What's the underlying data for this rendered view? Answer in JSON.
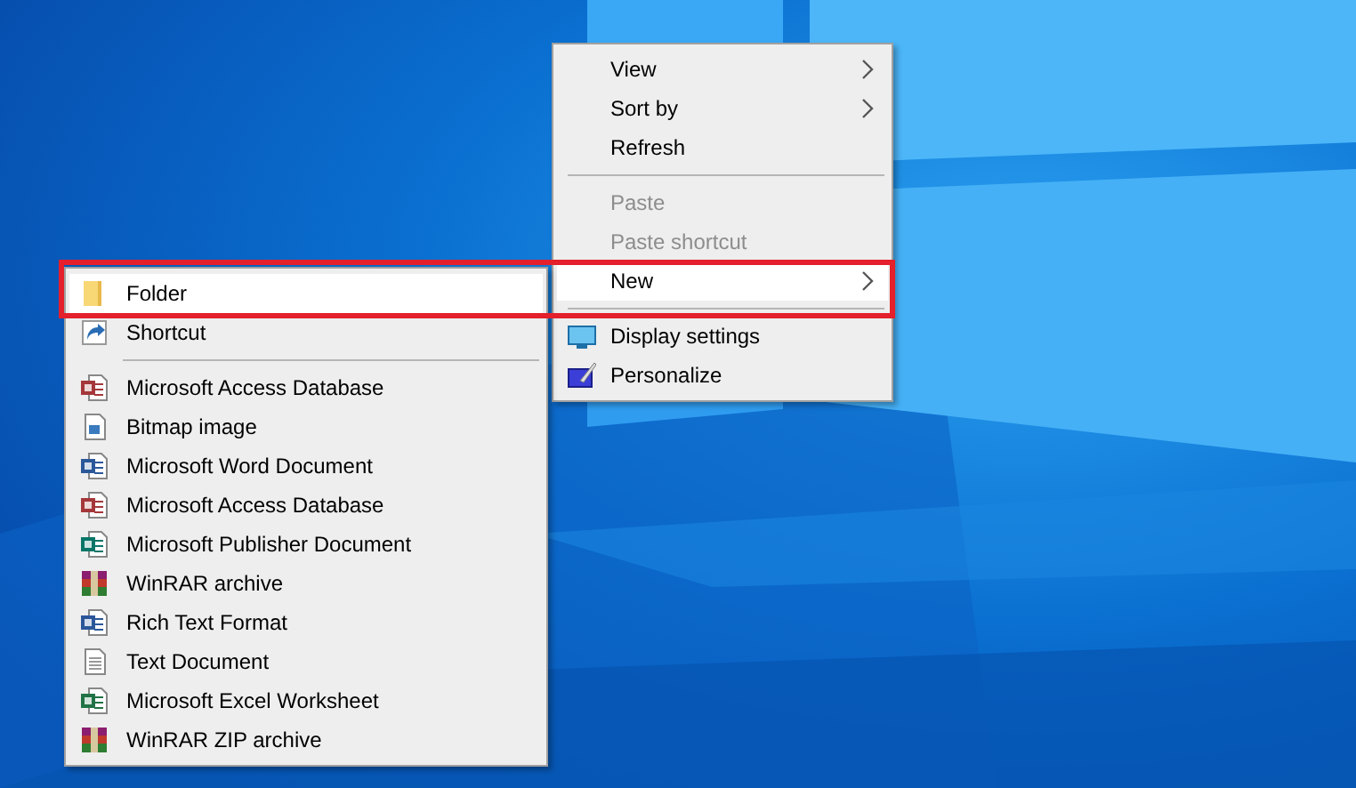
{
  "desktop_menu": {
    "items": [
      {
        "kind": "item",
        "label": "View",
        "submenu": true,
        "disabled": false,
        "selected": false
      },
      {
        "kind": "item",
        "label": "Sort by",
        "submenu": true,
        "disabled": false,
        "selected": false
      },
      {
        "kind": "item",
        "label": "Refresh",
        "submenu": false,
        "disabled": false,
        "selected": false
      },
      {
        "kind": "separator"
      },
      {
        "kind": "item",
        "label": "Paste",
        "submenu": false,
        "disabled": true,
        "selected": false
      },
      {
        "kind": "item",
        "label": "Paste shortcut",
        "submenu": false,
        "disabled": true,
        "selected": false
      },
      {
        "kind": "item",
        "label": "New",
        "submenu": true,
        "disabled": false,
        "selected": true
      },
      {
        "kind": "separator"
      },
      {
        "kind": "display",
        "label": "Display settings",
        "submenu": false,
        "disabled": false,
        "selected": false
      },
      {
        "kind": "personalize",
        "label": "Personalize",
        "submenu": false,
        "disabled": false,
        "selected": false
      }
    ]
  },
  "new_submenu": {
    "items": [
      {
        "kind": "folder",
        "label": "Folder",
        "selected": true
      },
      {
        "kind": "shortcut",
        "label": "Shortcut",
        "selected": false
      },
      {
        "kind": "separator"
      },
      {
        "kind": "access",
        "label": "Microsoft Access Database",
        "selected": false
      },
      {
        "kind": "bitmap",
        "label": "Bitmap image",
        "selected": false
      },
      {
        "kind": "word",
        "label": "Microsoft Word Document",
        "selected": false
      },
      {
        "kind": "access2",
        "label": "Microsoft Access Database",
        "selected": false
      },
      {
        "kind": "publisher",
        "label": "Microsoft Publisher Document",
        "selected": false
      },
      {
        "kind": "winrar",
        "label": "WinRAR archive",
        "selected": false
      },
      {
        "kind": "rtf",
        "label": "Rich Text Format",
        "selected": false
      },
      {
        "kind": "text",
        "label": "Text Document",
        "selected": false
      },
      {
        "kind": "excel",
        "label": "Microsoft Excel Worksheet",
        "selected": false
      },
      {
        "kind": "winrar",
        "label": "WinRAR ZIP archive",
        "selected": false
      }
    ]
  }
}
